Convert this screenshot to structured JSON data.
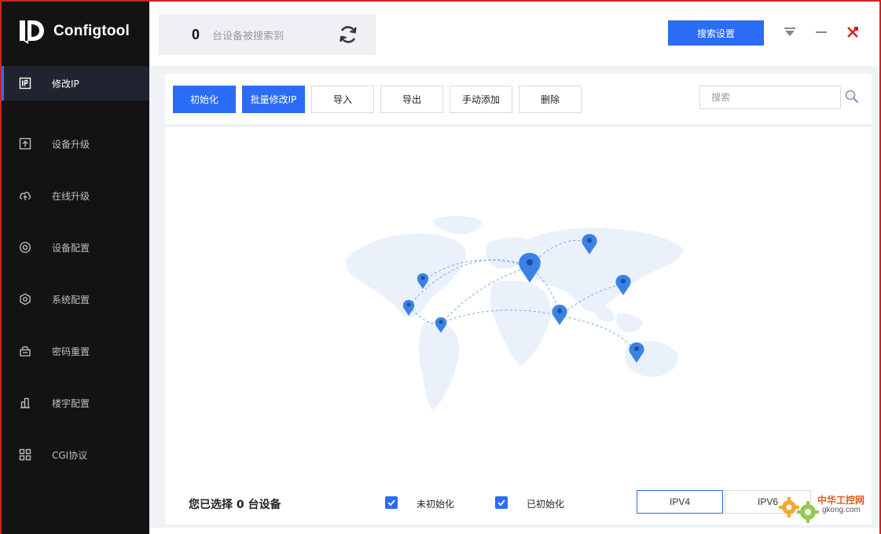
{
  "app": {
    "name": "Configtool"
  },
  "sidebar": {
    "items": [
      {
        "label": "修改IP",
        "icon": "ip-icon",
        "active": true
      },
      {
        "label": "设备升级",
        "icon": "upload-icon"
      },
      {
        "label": "在线升级",
        "icon": "cloud-upload-icon"
      },
      {
        "label": "设备配置",
        "icon": "device-config-icon"
      },
      {
        "label": "系统配置",
        "icon": "system-config-icon"
      },
      {
        "label": "密码重置",
        "icon": "lock-icon"
      },
      {
        "label": "楼宇配置",
        "icon": "building-icon"
      },
      {
        "label": "CGI协议",
        "icon": "grid-icon"
      }
    ]
  },
  "header": {
    "device_count": "0",
    "device_count_label": "台设备被搜索到",
    "search_settings_label": "搜索设置"
  },
  "toolbar": {
    "init_label": "初始化",
    "batch_modify_label": "批量修改IP",
    "import_label": "导入",
    "export_label": "导出",
    "manual_add_label": "手动添加",
    "delete_label": "删除",
    "search_placeholder": "搜索"
  },
  "footer": {
    "selected_text": "您已选择 0 台设备",
    "uninitialized_label": "未初始化",
    "initialized_label": "已初始化",
    "uninitialized_checked": true,
    "initialized_checked": true,
    "ipv4_label": "IPV4",
    "ipv6_label": "IPV6"
  },
  "watermark": {
    "title": "中华工控网",
    "url": "gkong.com"
  },
  "colors": {
    "accent": "#2a6cf5",
    "sidebar_bg": "#131313",
    "frame_border": "#d32020"
  }
}
